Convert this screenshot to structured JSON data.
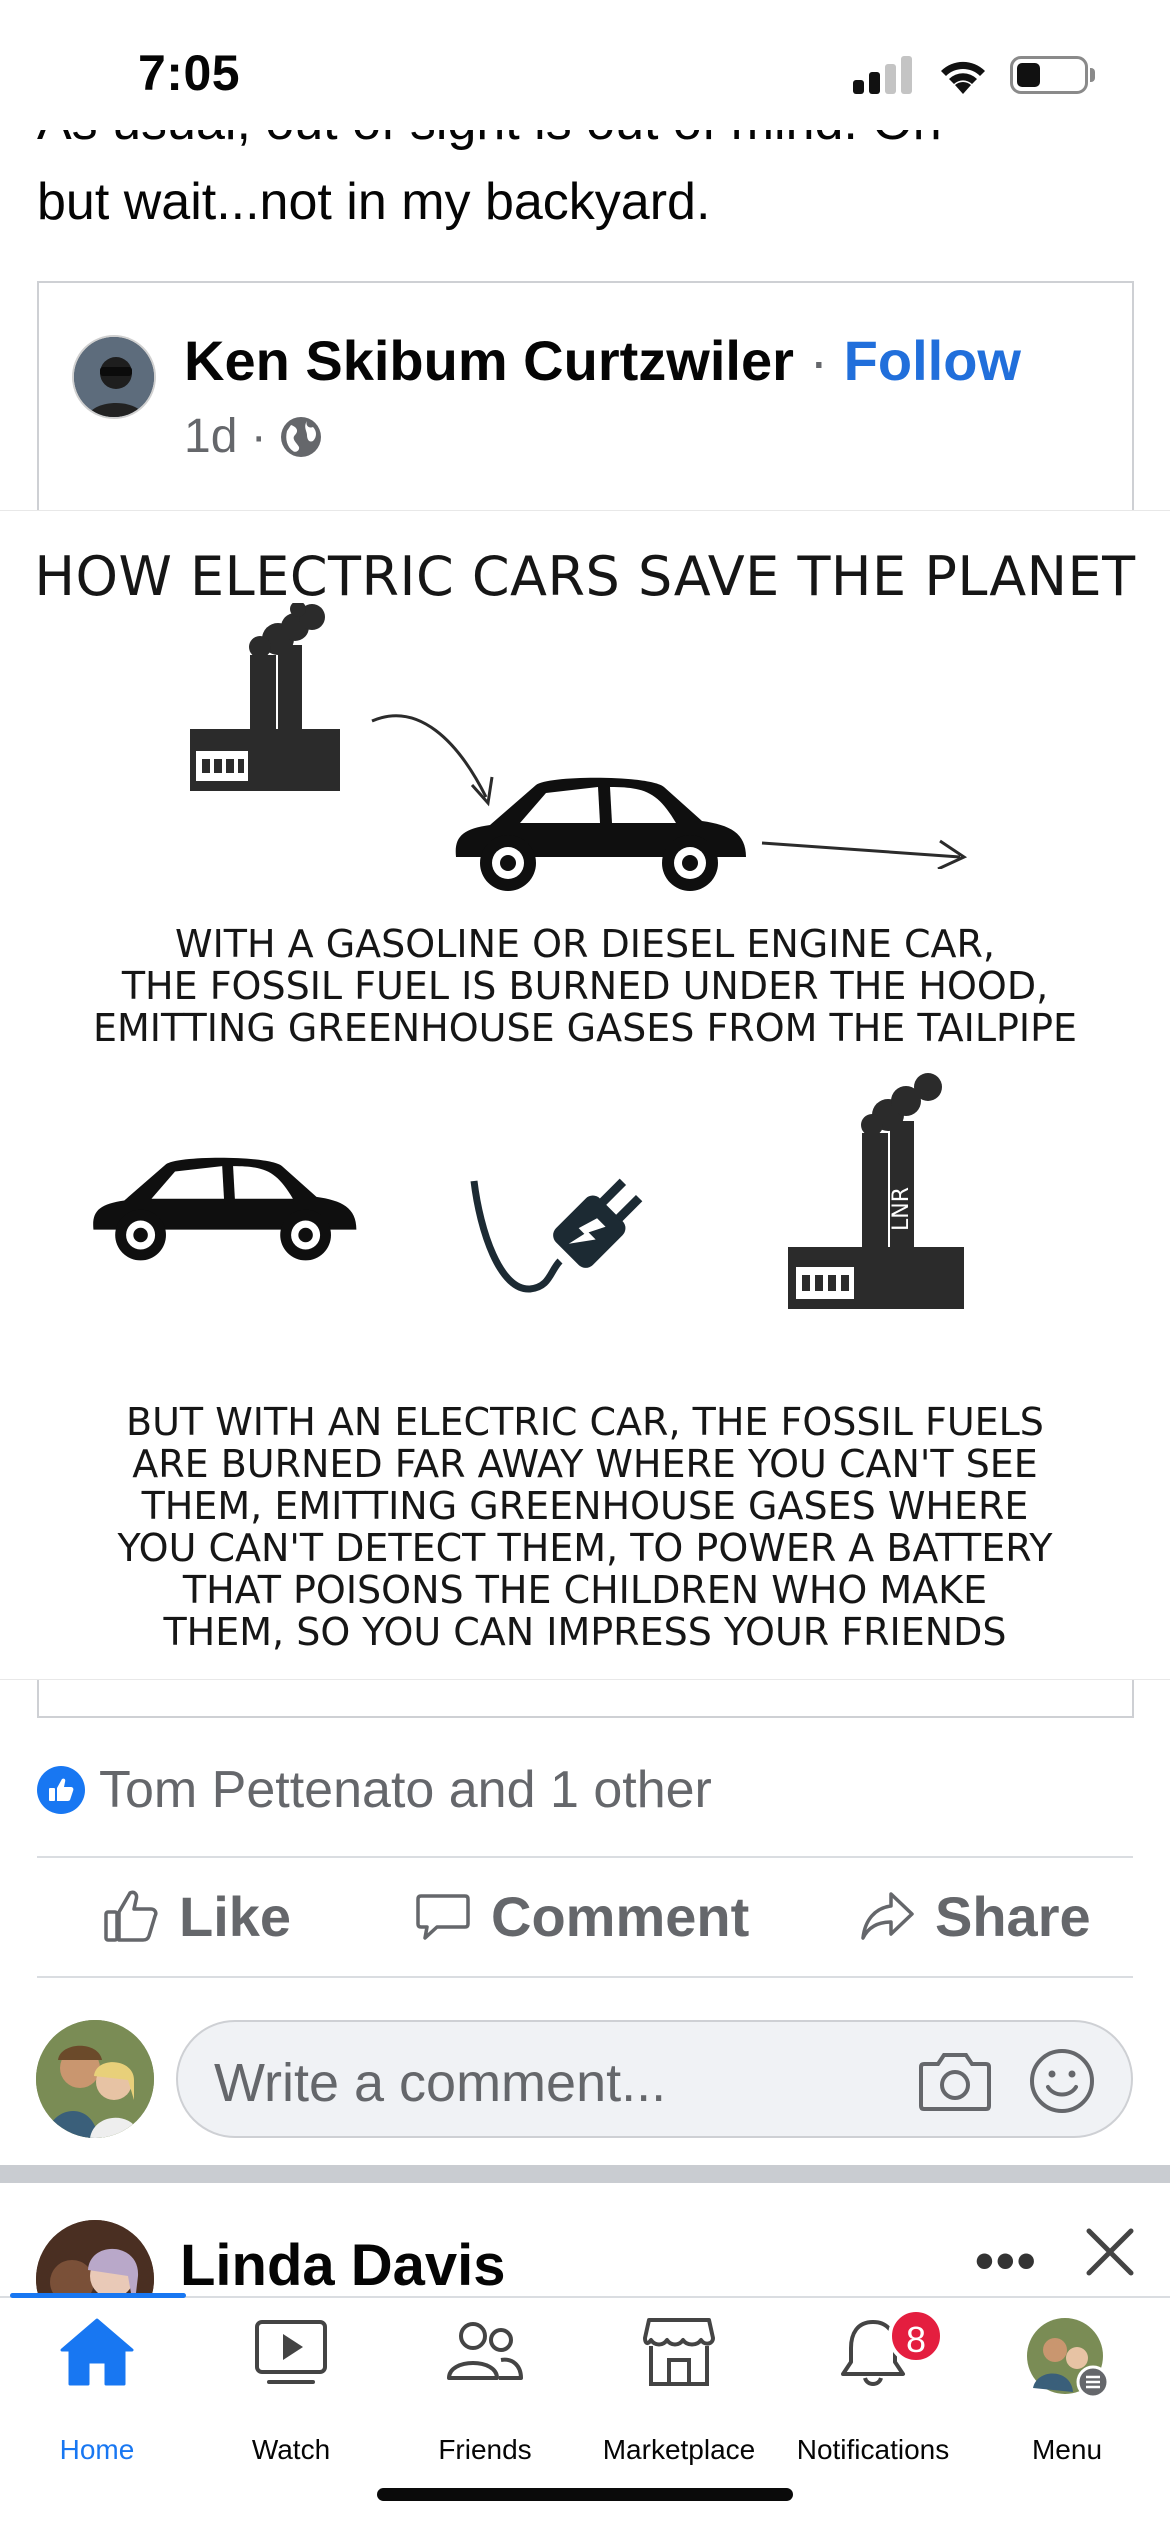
{
  "status_bar": {
    "time": "7:05",
    "battery_level": 0.35
  },
  "post": {
    "text_clipped": "As usual, out of sight is out of mind. Oh",
    "text_line": "but wait...not in my backyard."
  },
  "shared_post": {
    "author": "Ken Skibum Curtzwiler",
    "separator": "·",
    "follow_label": "Follow",
    "time": "1d ·",
    "meme": {
      "title": "HOW ELECTRIC CARS SAVE THE PLANET",
      "caption1_lines": [
        "WITH A GASOLINE OR DIESEL ENGINE CAR,",
        "THE FOSSIL FUEL IS BURNED UNDER THE HOOD,",
        "EMITTING GREENHOUSE GASES FROM THE TAILPIPE"
      ],
      "caption2_lines": [
        "BUT WITH AN ELECTRIC CAR, THE FOSSIL FUELS",
        "ARE BURNED FAR AWAY WHERE YOU CAN'T SEE",
        "THEM, EMITTING GREENHOUSE GASES WHERE",
        "YOU CAN'T DETECT THEM, TO POWER A BATTERY",
        "THAT POISONS THE CHILDREN WHO MAKE",
        "THEM, SO YOU CAN IMPRESS YOUR FRIENDS"
      ],
      "factory_label": "LNR"
    }
  },
  "reactions": {
    "text": "Tom Pettenato and 1 other"
  },
  "actions": {
    "like": "Like",
    "comment": "Comment",
    "share": "Share"
  },
  "composer": {
    "placeholder": "Write a comment..."
  },
  "next_post": {
    "author": "Linda Davis",
    "more": "•••"
  },
  "tabs": [
    {
      "label": "Home",
      "icon": "home-icon",
      "active": true
    },
    {
      "label": "Watch",
      "icon": "watch-icon"
    },
    {
      "label": "Friends",
      "icon": "friends-icon"
    },
    {
      "label": "Marketplace",
      "icon": "marketplace-icon"
    },
    {
      "label": "Notifications",
      "icon": "bell-icon",
      "badge": "8"
    },
    {
      "label": "Menu",
      "icon": "menu-avatar-icon"
    }
  ],
  "colors": {
    "accent": "#1877f2",
    "secondary_text": "#65676b",
    "badge": "#e41e3f"
  }
}
